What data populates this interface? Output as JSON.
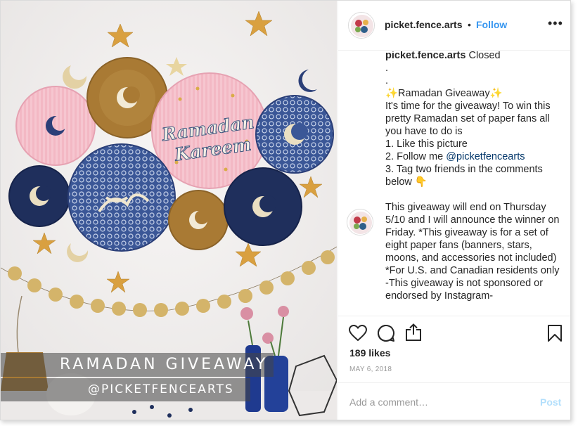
{
  "post": {
    "username": "picket.fence.arts",
    "separator": "•",
    "follow_label": "Follow",
    "more_label": "•••"
  },
  "photo": {
    "overlay_title": "RAMADAN GIVEAWAY",
    "overlay_handle": "@PICKETFENCEARTS",
    "fan_text_line1": "Ramadan",
    "fan_text_line2": "Kareem"
  },
  "caption": {
    "username": "picket.fence.arts",
    "first_text": " Closed",
    "lines": [
      ".",
      ".",
      "✨Ramadan Giveaway✨",
      "It's time for the giveaway! To win this",
      "pretty Ramadan set of paper fans all",
      "you have to do is",
      "1. Like this picture",
      "2. Follow me ",
      "3. Tag two friends in the comments",
      "below 👇"
    ],
    "mention": "@picketfencearts"
  },
  "comment2": {
    "lines": [
      "This giveaway will end on Thursday",
      "5/10 and I will announce the winner on",
      "Friday. *This giveaway is for a set of",
      "eight paper fans (banners, stars,",
      "moons, and accessories not included)",
      "*For U.S. and Canadian residents only",
      "-This giveaway is not sponsored or",
      "endorsed by Instagram-"
    ]
  },
  "actions": {
    "like_icon": "heart-icon",
    "comment_icon": "comment-icon",
    "share_icon": "share-icon",
    "save_icon": "bookmark-icon",
    "likes": "189 likes",
    "date": "MAY 6, 2018"
  },
  "comment_bar": {
    "placeholder": "Add a comment…",
    "post_label": "Post"
  },
  "colors": {
    "follow": "#3897f0",
    "post_disabled": "#b2dffc",
    "text": "#262626",
    "muted": "#999999"
  }
}
